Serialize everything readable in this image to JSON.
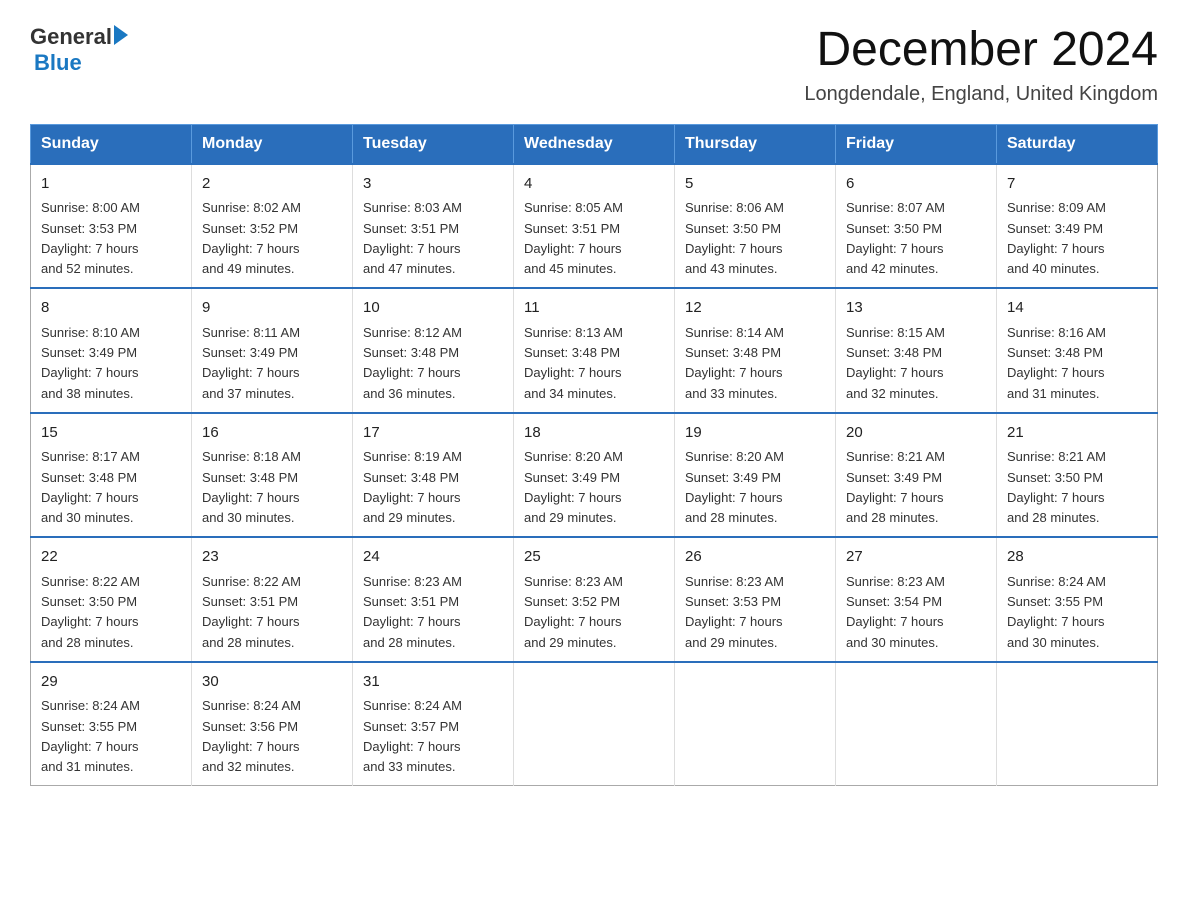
{
  "logo": {
    "general": "General",
    "blue": "Blue"
  },
  "title": "December 2024",
  "subtitle": "Longdendale, England, United Kingdom",
  "headers": [
    "Sunday",
    "Monday",
    "Tuesday",
    "Wednesday",
    "Thursday",
    "Friday",
    "Saturday"
  ],
  "weeks": [
    [
      {
        "day": "1",
        "info": "Sunrise: 8:00 AM\nSunset: 3:53 PM\nDaylight: 7 hours\nand 52 minutes."
      },
      {
        "day": "2",
        "info": "Sunrise: 8:02 AM\nSunset: 3:52 PM\nDaylight: 7 hours\nand 49 minutes."
      },
      {
        "day": "3",
        "info": "Sunrise: 8:03 AM\nSunset: 3:51 PM\nDaylight: 7 hours\nand 47 minutes."
      },
      {
        "day": "4",
        "info": "Sunrise: 8:05 AM\nSunset: 3:51 PM\nDaylight: 7 hours\nand 45 minutes."
      },
      {
        "day": "5",
        "info": "Sunrise: 8:06 AM\nSunset: 3:50 PM\nDaylight: 7 hours\nand 43 minutes."
      },
      {
        "day": "6",
        "info": "Sunrise: 8:07 AM\nSunset: 3:50 PM\nDaylight: 7 hours\nand 42 minutes."
      },
      {
        "day": "7",
        "info": "Sunrise: 8:09 AM\nSunset: 3:49 PM\nDaylight: 7 hours\nand 40 minutes."
      }
    ],
    [
      {
        "day": "8",
        "info": "Sunrise: 8:10 AM\nSunset: 3:49 PM\nDaylight: 7 hours\nand 38 minutes."
      },
      {
        "day": "9",
        "info": "Sunrise: 8:11 AM\nSunset: 3:49 PM\nDaylight: 7 hours\nand 37 minutes."
      },
      {
        "day": "10",
        "info": "Sunrise: 8:12 AM\nSunset: 3:48 PM\nDaylight: 7 hours\nand 36 minutes."
      },
      {
        "day": "11",
        "info": "Sunrise: 8:13 AM\nSunset: 3:48 PM\nDaylight: 7 hours\nand 34 minutes."
      },
      {
        "day": "12",
        "info": "Sunrise: 8:14 AM\nSunset: 3:48 PM\nDaylight: 7 hours\nand 33 minutes."
      },
      {
        "day": "13",
        "info": "Sunrise: 8:15 AM\nSunset: 3:48 PM\nDaylight: 7 hours\nand 32 minutes."
      },
      {
        "day": "14",
        "info": "Sunrise: 8:16 AM\nSunset: 3:48 PM\nDaylight: 7 hours\nand 31 minutes."
      }
    ],
    [
      {
        "day": "15",
        "info": "Sunrise: 8:17 AM\nSunset: 3:48 PM\nDaylight: 7 hours\nand 30 minutes."
      },
      {
        "day": "16",
        "info": "Sunrise: 8:18 AM\nSunset: 3:48 PM\nDaylight: 7 hours\nand 30 minutes."
      },
      {
        "day": "17",
        "info": "Sunrise: 8:19 AM\nSunset: 3:48 PM\nDaylight: 7 hours\nand 29 minutes."
      },
      {
        "day": "18",
        "info": "Sunrise: 8:20 AM\nSunset: 3:49 PM\nDaylight: 7 hours\nand 29 minutes."
      },
      {
        "day": "19",
        "info": "Sunrise: 8:20 AM\nSunset: 3:49 PM\nDaylight: 7 hours\nand 28 minutes."
      },
      {
        "day": "20",
        "info": "Sunrise: 8:21 AM\nSunset: 3:49 PM\nDaylight: 7 hours\nand 28 minutes."
      },
      {
        "day": "21",
        "info": "Sunrise: 8:21 AM\nSunset: 3:50 PM\nDaylight: 7 hours\nand 28 minutes."
      }
    ],
    [
      {
        "day": "22",
        "info": "Sunrise: 8:22 AM\nSunset: 3:50 PM\nDaylight: 7 hours\nand 28 minutes."
      },
      {
        "day": "23",
        "info": "Sunrise: 8:22 AM\nSunset: 3:51 PM\nDaylight: 7 hours\nand 28 minutes."
      },
      {
        "day": "24",
        "info": "Sunrise: 8:23 AM\nSunset: 3:51 PM\nDaylight: 7 hours\nand 28 minutes."
      },
      {
        "day": "25",
        "info": "Sunrise: 8:23 AM\nSunset: 3:52 PM\nDaylight: 7 hours\nand 29 minutes."
      },
      {
        "day": "26",
        "info": "Sunrise: 8:23 AM\nSunset: 3:53 PM\nDaylight: 7 hours\nand 29 minutes."
      },
      {
        "day": "27",
        "info": "Sunrise: 8:23 AM\nSunset: 3:54 PM\nDaylight: 7 hours\nand 30 minutes."
      },
      {
        "day": "28",
        "info": "Sunrise: 8:24 AM\nSunset: 3:55 PM\nDaylight: 7 hours\nand 30 minutes."
      }
    ],
    [
      {
        "day": "29",
        "info": "Sunrise: 8:24 AM\nSunset: 3:55 PM\nDaylight: 7 hours\nand 31 minutes."
      },
      {
        "day": "30",
        "info": "Sunrise: 8:24 AM\nSunset: 3:56 PM\nDaylight: 7 hours\nand 32 minutes."
      },
      {
        "day": "31",
        "info": "Sunrise: 8:24 AM\nSunset: 3:57 PM\nDaylight: 7 hours\nand 33 minutes."
      },
      {
        "day": "",
        "info": ""
      },
      {
        "day": "",
        "info": ""
      },
      {
        "day": "",
        "info": ""
      },
      {
        "day": "",
        "info": ""
      }
    ]
  ]
}
